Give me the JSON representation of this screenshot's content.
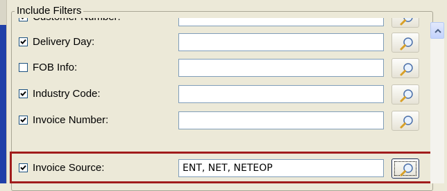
{
  "group": {
    "title": "Include Filters"
  },
  "filters": [
    {
      "label": "Customer Number:",
      "checked": true,
      "value": ""
    },
    {
      "label": "Delivery Day:",
      "checked": true,
      "value": ""
    },
    {
      "label": "FOB Info:",
      "checked": false,
      "value": ""
    },
    {
      "label": "Industry Code:",
      "checked": true,
      "value": ""
    },
    {
      "label": "Invoice Number:",
      "checked": true,
      "value": ""
    },
    {
      "label": "Invoice Source:",
      "checked": true,
      "value": "ENT, NET, NETEOP"
    }
  ],
  "icons": {
    "lookup": "magnifier-icon",
    "scroll": "scroll-up-arrow-icon"
  },
  "colors": {
    "highlight": "#a11c1c",
    "checkmark": "#21a121",
    "left_panel": "#1f3fa8"
  }
}
